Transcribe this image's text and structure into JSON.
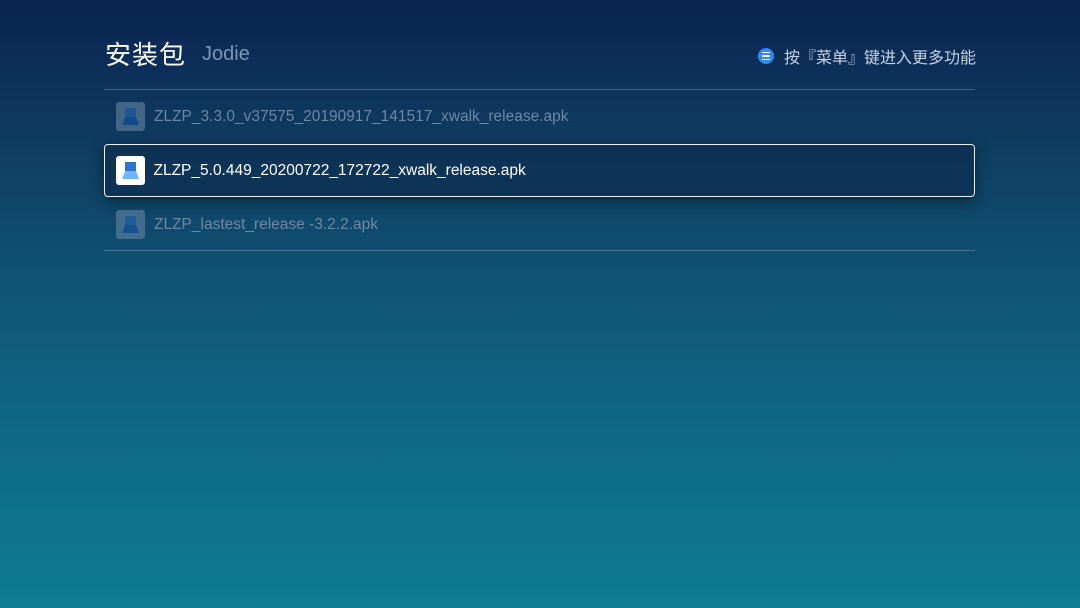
{
  "header": {
    "title": "安装包",
    "subtitle": "Jodie",
    "hint": {
      "icon": "menu-icon",
      "text": "按『菜单』键进入更多功能"
    }
  },
  "colors": {
    "accent": "#2e8cf0",
    "background_top": "#0a2350",
    "background_bottom": "#0e7d94"
  },
  "files": [
    {
      "name": "ZLZP_3.3.0_v37575_20190917_141517_xwalk_release.apk",
      "icon": "apk-icon",
      "focused": false
    },
    {
      "name": "ZLZP_5.0.449_20200722_172722_xwalk_release.apk",
      "icon": "apk-icon",
      "focused": true
    },
    {
      "name": "ZLZP_lastest_release -3.2.2.apk",
      "icon": "apk-icon",
      "focused": false
    }
  ]
}
